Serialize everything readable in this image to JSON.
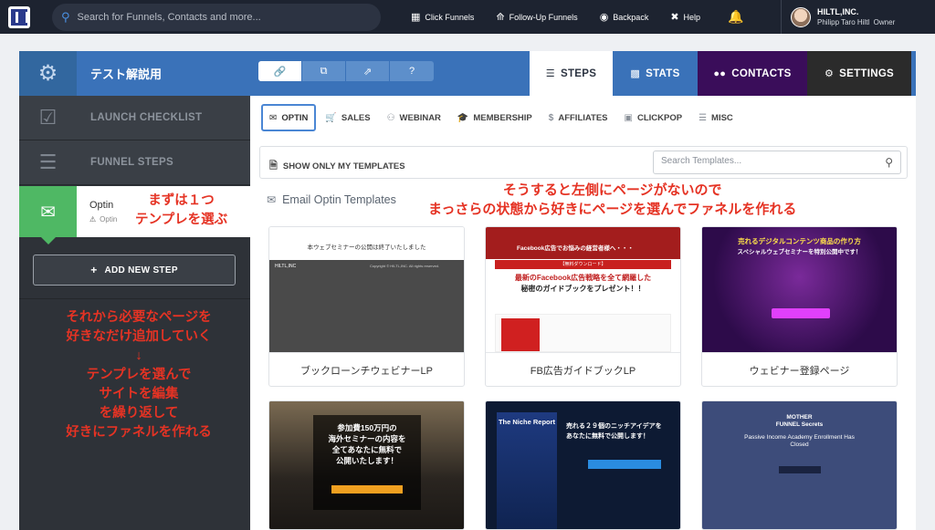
{
  "topnav": {
    "search_placeholder": "Search for Funnels, Contacts and more...",
    "links": [
      {
        "label": "Click Funnels",
        "icon": "clickfunnels-icon"
      },
      {
        "label": "Follow-Up Funnels",
        "icon": "follow-up-icon"
      },
      {
        "label": "Backpack",
        "icon": "backpack-icon"
      },
      {
        "label": "Help",
        "icon": "help-icon"
      }
    ],
    "account": {
      "company": "HILTL,INC.",
      "user": "Philipp Taro Hiltl",
      "role": "Owner"
    }
  },
  "funnel": {
    "title": "テスト解説用",
    "tabs": [
      {
        "label": "STEPS",
        "active": true
      },
      {
        "label": "STATS",
        "active": false
      },
      {
        "label": "CONTACTS",
        "active": false
      },
      {
        "label": "SETTINGS",
        "active": false
      }
    ]
  },
  "sidebar": {
    "launch_checklist": "LAUNCH CHECKLIST",
    "funnel_steps": "FUNNEL STEPS",
    "step": {
      "name": "Optin",
      "sub": "Optin"
    },
    "add_step": "ADD NEW STEP"
  },
  "main": {
    "categories": [
      {
        "label": "OPTIN",
        "active": true
      },
      {
        "label": "SALES",
        "active": false
      },
      {
        "label": "WEBINAR",
        "active": false
      },
      {
        "label": "MEMBERSHIP",
        "active": false
      },
      {
        "label": "AFFILIATES",
        "active": false
      },
      {
        "label": "CLICKPOP",
        "active": false
      },
      {
        "label": "MISC",
        "active": false
      }
    ],
    "filter_label": "SHOW ONLY MY TEMPLATES",
    "template_search_placeholder": "Search Templates...",
    "section_title": "Email Optin Templates",
    "cards": [
      {
        "label": "ブックローンチウェビナーLP"
      },
      {
        "label": "FB広告ガイドブックLP"
      },
      {
        "label": "ウェビナー登録ページ"
      }
    ],
    "thumbs": {
      "t1_band": "本ウェブセミナーの公開は終了いたしました",
      "t1_brand": "HILTL,INC",
      "t1_copy": "Copyright © HILTL,INC. All rights reserved.",
      "t2_top": "Facebook広告でお悩みの経営者様へ・・・",
      "t2_dl": "【無料ダウンロード】",
      "t2_h1": "最新のFacebook広告戦略を全て網羅した",
      "t2_h2": "秘密のガイドブックをプレゼント！！",
      "t3_h": "売れるデジタルコンテンツ商品の作り方",
      "t3_h2": "スペシャルウェブセミナーを特別公開中です！",
      "t4_l1": "参加費150万円の",
      "t4_l2": "海外セミナーの内容を",
      "t4_l3": "全てあなたに無料で",
      "t4_l4": "公開いたします！",
      "t5_book": "The Niche Report",
      "t5_l1": "売れる２９個のニッチアイデアを",
      "t5_l2": "あなたに無料で公開します！",
      "t6_logo1": "MOTHER",
      "t6_logo2": "FUNNEL Secrets",
      "t6_h1": "Passive Income Academy Enrollment Has",
      "t6_h2": "Closed"
    }
  },
  "annotations": {
    "a1": [
      "まずは１つ",
      "テンプレを選ぶ"
    ],
    "a2": [
      "そうすると左側にページがないので",
      "まっさらの状態から好きにページを選んでファネルを作れる"
    ],
    "a3": [
      "それから必要なページを",
      "好きなだけ追加していく",
      "↓",
      "テンプレを選んで",
      "サイトを編集",
      "を繰り返して",
      "好きにファネルを作れる"
    ]
  },
  "colors": {
    "accent": "#3a72b9",
    "topnav": "#1d2330",
    "sidebar": "#2e3238",
    "step_green": "#4fb864",
    "annotation": "#e53324"
  }
}
